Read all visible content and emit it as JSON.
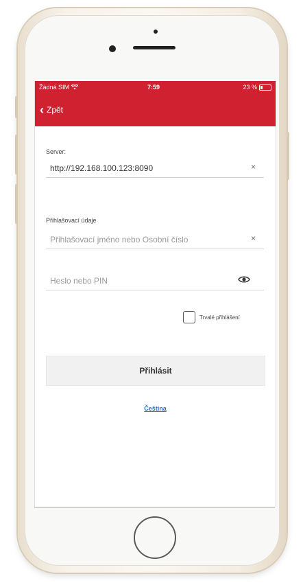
{
  "status_bar": {
    "carrier": "Žádná SIM",
    "time": "7:59",
    "battery": "23 %",
    "battery_level": 0.23
  },
  "nav": {
    "back_label": "Zpět"
  },
  "form": {
    "server_label": "Server:",
    "server_value": "http://192.168.100.123:8090",
    "credentials_label": "Přihlašovací údaje",
    "username_placeholder": "Přihlašovací jméno nebo Osobní číslo",
    "password_placeholder": "Heslo nebo PIN",
    "clear_symbol": "×",
    "remember_label": "Trvalé přihlášení",
    "login_button": "Přihlásit",
    "language_link": "Čeština"
  },
  "colors": {
    "header": "#cf2130",
    "link": "#1e6fd9"
  }
}
